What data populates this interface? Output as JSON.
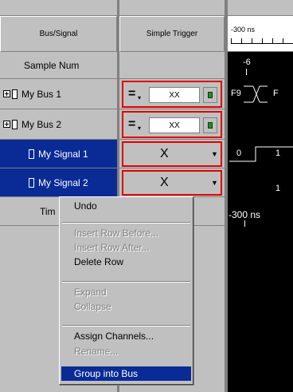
{
  "columns": {
    "bus_signal": "Bus/Signal",
    "simple_trigger": "Simple Trigger",
    "timeline_label": "-300 ns"
  },
  "rows": [
    {
      "label": "Sample Num",
      "wave": "-6"
    },
    {
      "label": "My Bus 1",
      "trigger_op": "=",
      "trigger_value": "XX",
      "wave_a": "F9",
      "wave_b": "F"
    },
    {
      "label": "My Bus 2",
      "trigger_op": "=",
      "trigger_value": "XX"
    },
    {
      "label": "My Signal 1",
      "trigger_value": "X",
      "wave_a": "0",
      "wave_b": "1"
    },
    {
      "label": "My Signal 2",
      "trigger_value": "X",
      "wave": "1"
    },
    {
      "label": "Tim",
      "wave": "-300 ns"
    }
  ],
  "context_menu": {
    "items": [
      {
        "label": "Undo",
        "enabled": true
      },
      {
        "label": "Insert Row Before...",
        "enabled": false
      },
      {
        "label": "Insert Row After...",
        "enabled": false
      },
      {
        "label": "Delete Row",
        "enabled": true
      },
      {
        "label": "Expand",
        "enabled": false
      },
      {
        "label": "Collapse",
        "enabled": false
      },
      {
        "label": "Assign Channels...",
        "enabled": true
      },
      {
        "label": "Rename...",
        "enabled": false
      },
      {
        "label": "Group into Bus",
        "enabled": true,
        "highlighted": true
      }
    ]
  },
  "colors": {
    "panel": "#c0c0c0",
    "selection": "#0a2b96",
    "trigger_outline": "#e00000",
    "waveform_bg": "#000000"
  }
}
